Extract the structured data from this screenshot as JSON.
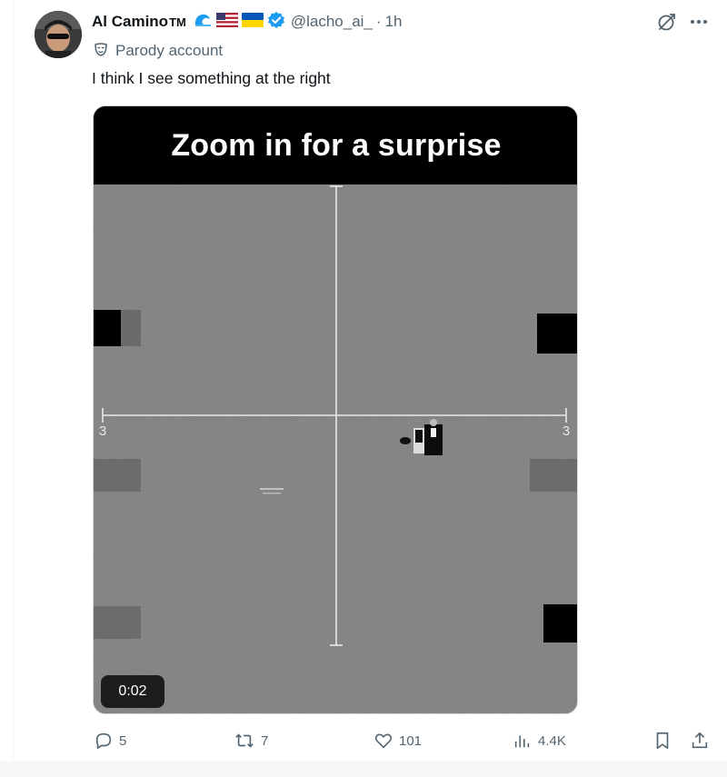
{
  "author": {
    "name": "Al Camino",
    "tm": "TM",
    "handle": "@lacho_ai_",
    "separator": "·",
    "time": "1h",
    "parody_label": "Parody account",
    "verified_color": "#1d9bf0"
  },
  "post": {
    "text": "I think I see something at the right"
  },
  "media": {
    "banner_text": "Zoom in for a surprise",
    "scale_left": "3",
    "scale_right": "3",
    "duration": "0:02"
  },
  "actions": {
    "replies": "5",
    "reposts": "7",
    "likes": "101",
    "views": "4.4K"
  },
  "icons": {
    "reply": "reply-icon",
    "repost": "repost-icon",
    "like": "heart-icon",
    "views": "views-chart-icon",
    "bookmark": "bookmark-icon",
    "share": "share-icon",
    "grok": "grok-icon",
    "more": "more-icon"
  }
}
